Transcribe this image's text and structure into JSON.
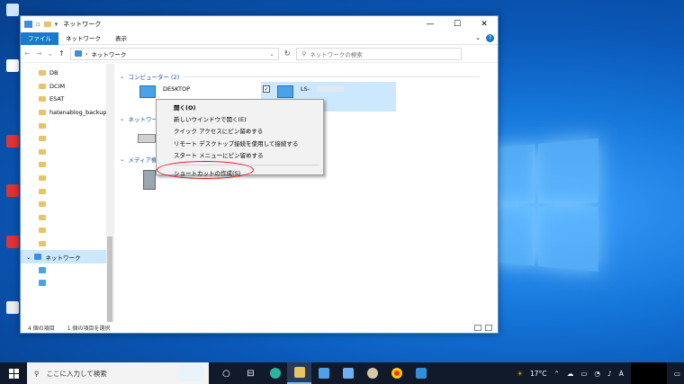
{
  "window": {
    "title": "ネットワーク",
    "minimize_glyph": "—",
    "maximize_glyph": "☐",
    "close_glyph": "✕"
  },
  "ribbon": {
    "tabs": [
      "ファイル",
      "ネットワーク",
      "表示"
    ]
  },
  "address": {
    "path": "ネットワーク",
    "search_placeholder": "ネットワークの検索"
  },
  "nav_pane": {
    "items": [
      {
        "label": "DB"
      },
      {
        "label": "DCIM"
      },
      {
        "label": "ESAT"
      },
      {
        "label": "hatenablog_backup"
      },
      {
        "label": ""
      },
      {
        "label": ""
      },
      {
        "label": ""
      },
      {
        "label": ""
      },
      {
        "label": ""
      },
      {
        "label": ""
      },
      {
        "label": ""
      },
      {
        "label": ""
      },
      {
        "label": ""
      },
      {
        "label": ""
      },
      {
        "label": "ネットワーク",
        "selected": true
      },
      {
        "label": ""
      },
      {
        "label": ""
      }
    ]
  },
  "content": {
    "group_computers": "コンピューター (2)",
    "group_network": "ネットワーク",
    "group_media": "メディア機器",
    "computers": [
      "DESKTOP",
      "LS-"
    ]
  },
  "context_menu": {
    "items": [
      "開く(O)",
      "新しいウインドウで開く(E)",
      "クイック アクセスにピン留めする",
      "リモート デスクトップ接続を使用して接続する",
      "スタート メニューにピン留めする",
      "ショートカットの作成(S)"
    ],
    "highlight_color": "#e0101a"
  },
  "statusbar": {
    "count": "4 個の項目",
    "selected": "1 個の項目を選択"
  },
  "taskbar": {
    "search_placeholder": "ここに入力して検索",
    "temperature": "17°C",
    "ime": "A"
  }
}
